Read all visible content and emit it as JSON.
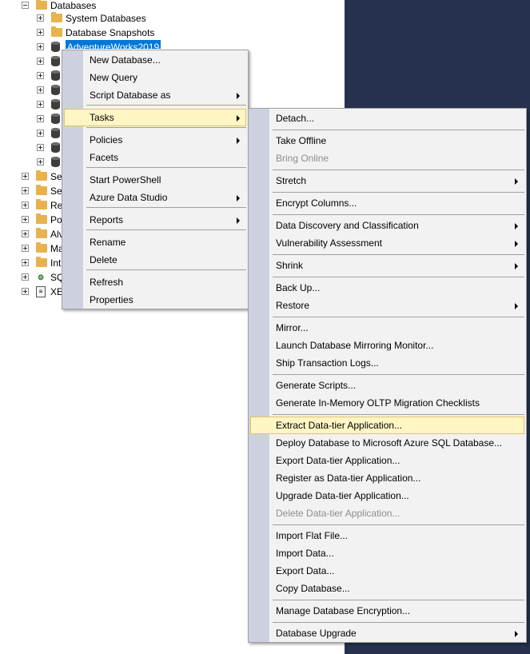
{
  "tree": {
    "rows": [
      {
        "label": "Databases",
        "icon": "folder-icon",
        "expander": "minus"
      },
      {
        "label": "System Databases",
        "icon": "folder-icon",
        "expander": "plus"
      },
      {
        "label": "Database Snapshots",
        "icon": "folder-icon",
        "expander": "plus"
      },
      {
        "label": "AdventureWorks2019",
        "icon": "database-icon",
        "expander": "plus",
        "selected": true
      },
      {
        "label": "",
        "icon": "database-icon",
        "expander": "plus"
      },
      {
        "label": "",
        "icon": "database-icon",
        "expander": "plus"
      },
      {
        "label": "",
        "icon": "database-icon",
        "expander": "plus"
      },
      {
        "label": "",
        "icon": "database-icon",
        "expander": "plus"
      },
      {
        "label": "",
        "icon": "database-icon",
        "expander": "plus"
      },
      {
        "label": "",
        "icon": "database-icon",
        "expander": "plus"
      },
      {
        "label": "",
        "icon": "database-icon",
        "expander": "plus"
      },
      {
        "label": "",
        "icon": "database-icon",
        "expander": "plus"
      },
      {
        "label": "Se",
        "icon": "folder-icon",
        "expander": "plus"
      },
      {
        "label": "Se",
        "icon": "folder-icon",
        "expander": "plus"
      },
      {
        "label": "Re",
        "icon": "folder-icon",
        "expander": "plus"
      },
      {
        "label": "Po",
        "icon": "folder-icon",
        "expander": "plus"
      },
      {
        "label": "Alv",
        "icon": "folder-icon",
        "expander": "plus"
      },
      {
        "label": "Ma",
        "icon": "folder-icon",
        "expander": "plus"
      },
      {
        "label": "Int",
        "icon": "folder-icon",
        "expander": "plus"
      },
      {
        "label": "SQ",
        "icon": "sql-agent-icon",
        "expander": "plus"
      },
      {
        "label": "XE",
        "icon": "xevent-profiler-icon",
        "expander": "plus"
      }
    ]
  },
  "context_menu": {
    "items": [
      {
        "type": "item",
        "label": "New Database..."
      },
      {
        "type": "item",
        "label": "New Query"
      },
      {
        "type": "item",
        "label": "Script Database as",
        "submenu": true
      },
      {
        "type": "sep"
      },
      {
        "type": "item",
        "label": "Tasks",
        "submenu": true,
        "highlight": true
      },
      {
        "type": "sep"
      },
      {
        "type": "item",
        "label": "Policies",
        "submenu": true
      },
      {
        "type": "item",
        "label": "Facets"
      },
      {
        "type": "sep"
      },
      {
        "type": "item",
        "label": "Start PowerShell"
      },
      {
        "type": "item",
        "label": "Azure Data Studio",
        "submenu": true
      },
      {
        "type": "sep"
      },
      {
        "type": "item",
        "label": "Reports",
        "submenu": true
      },
      {
        "type": "sep"
      },
      {
        "type": "item",
        "label": "Rename"
      },
      {
        "type": "item",
        "label": "Delete"
      },
      {
        "type": "sep"
      },
      {
        "type": "item",
        "label": "Refresh"
      },
      {
        "type": "item",
        "label": "Properties"
      }
    ]
  },
  "tasks_submenu": {
    "items": [
      {
        "type": "item",
        "label": "Detach..."
      },
      {
        "type": "sep"
      },
      {
        "type": "item",
        "label": "Take Offline"
      },
      {
        "type": "item",
        "label": "Bring Online",
        "disabled": true
      },
      {
        "type": "sep"
      },
      {
        "type": "item",
        "label": "Stretch",
        "submenu": true
      },
      {
        "type": "sep"
      },
      {
        "type": "item",
        "label": "Encrypt Columns..."
      },
      {
        "type": "sep"
      },
      {
        "type": "item",
        "label": "Data Discovery and Classification",
        "submenu": true
      },
      {
        "type": "item",
        "label": "Vulnerability Assessment",
        "submenu": true
      },
      {
        "type": "sep"
      },
      {
        "type": "item",
        "label": "Shrink",
        "submenu": true
      },
      {
        "type": "sep"
      },
      {
        "type": "item",
        "label": "Back Up..."
      },
      {
        "type": "item",
        "label": "Restore",
        "submenu": true
      },
      {
        "type": "sep"
      },
      {
        "type": "item",
        "label": "Mirror..."
      },
      {
        "type": "item",
        "label": "Launch Database Mirroring Monitor..."
      },
      {
        "type": "item",
        "label": "Ship Transaction Logs..."
      },
      {
        "type": "sep"
      },
      {
        "type": "item",
        "label": "Generate Scripts..."
      },
      {
        "type": "item",
        "label": "Generate In-Memory OLTP Migration Checklists"
      },
      {
        "type": "sep"
      },
      {
        "type": "item",
        "label": "Extract Data-tier Application...",
        "highlight": true
      },
      {
        "type": "item",
        "label": "Deploy Database to Microsoft Azure SQL Database..."
      },
      {
        "type": "item",
        "label": "Export Data-tier Application..."
      },
      {
        "type": "item",
        "label": "Register as Data-tier Application..."
      },
      {
        "type": "item",
        "label": "Upgrade Data-tier Application..."
      },
      {
        "type": "item",
        "label": "Delete Data-tier Application...",
        "disabled": true
      },
      {
        "type": "sep"
      },
      {
        "type": "item",
        "label": "Import Flat File..."
      },
      {
        "type": "item",
        "label": "Import Data..."
      },
      {
        "type": "item",
        "label": "Export Data..."
      },
      {
        "type": "item",
        "label": "Copy Database..."
      },
      {
        "type": "sep"
      },
      {
        "type": "item",
        "label": "Manage Database Encryption..."
      },
      {
        "type": "sep"
      },
      {
        "type": "item",
        "label": "Database Upgrade",
        "submenu": true
      }
    ]
  },
  "colors": {
    "background_band": "#26324d",
    "selection": "#0078d7",
    "menu_highlight": "#fff6c4",
    "menu_gutter": "#cdd1df"
  }
}
